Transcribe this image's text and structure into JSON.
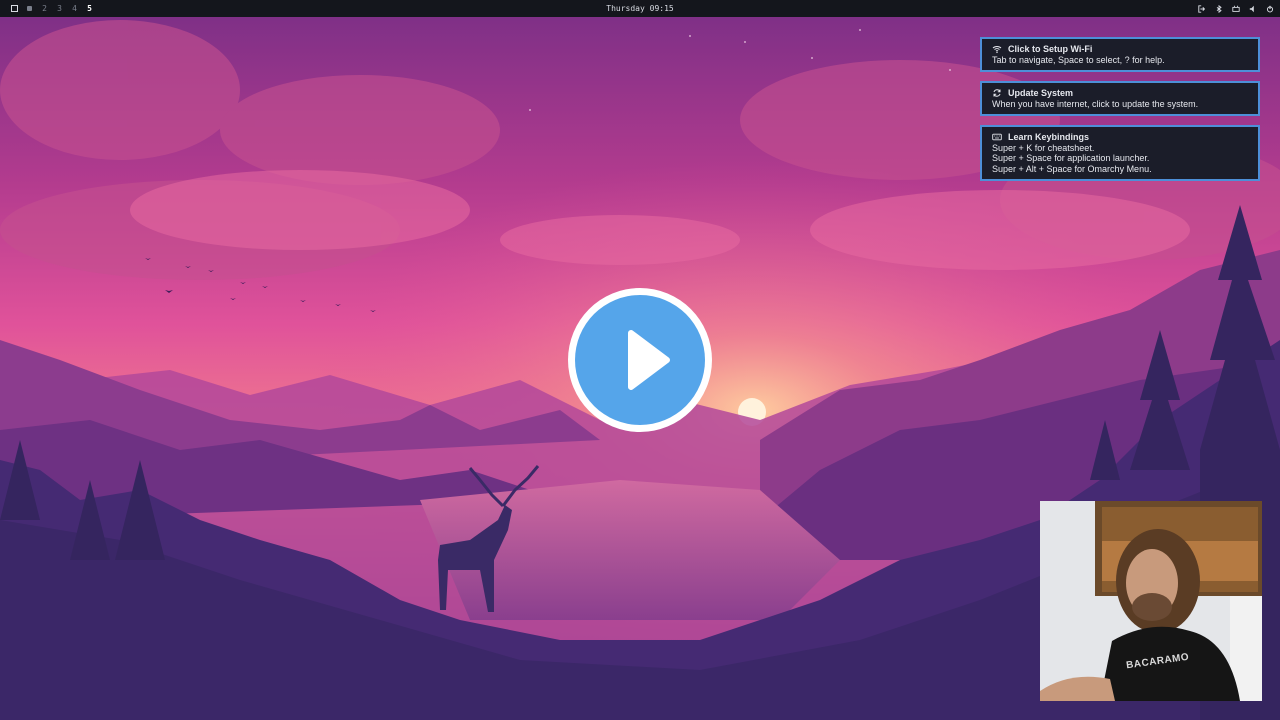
{
  "topbar": {
    "workspaces": [
      {
        "label": "",
        "active": false
      },
      {
        "label": "2",
        "active": false
      },
      {
        "label": "3",
        "active": false
      },
      {
        "label": "4",
        "active": false
      },
      {
        "label": "5",
        "active": true
      }
    ],
    "clock": "Thursday 09:15",
    "tray_icons": [
      "logout-icon",
      "bluetooth-icon",
      "network-icon",
      "volume-icon",
      "power-icon"
    ]
  },
  "notifications": [
    {
      "icon": "wifi-icon",
      "title": "Click to Setup Wi-Fi",
      "lines": [
        "Tab to navigate, Space to select, ? for help."
      ]
    },
    {
      "icon": "refresh-icon",
      "title": "Update System",
      "lines": [
        "When you have internet, click to update the system."
      ]
    },
    {
      "icon": "keyboard-icon",
      "title": "Learn Keybindings",
      "lines": [
        "Super + K for cheatsheet.",
        "Super + Space for application launcher.",
        "Super + Alt + Space for Omarchy Menu."
      ]
    }
  ],
  "video": {
    "play_icon": "play-icon",
    "accent": "#55a5ea"
  },
  "webcam": {
    "shirt_text": "BACARAMO"
  },
  "colors": {
    "accent": "#4d8fd8",
    "bar_bg": "#14161c",
    "notif_bg": "#1b1d29"
  }
}
